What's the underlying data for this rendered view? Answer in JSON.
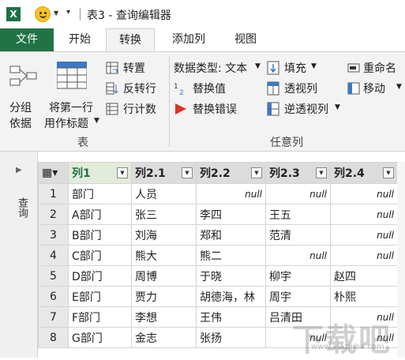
{
  "window": {
    "title": "表3 - 查询编辑器",
    "excel_badge": "X"
  },
  "tabs": [
    "文件",
    "开始",
    "转换",
    "添加列",
    "视图"
  ],
  "ribbon": {
    "group_table": {
      "label": "表",
      "group_by": [
        "分组",
        "依据"
      ],
      "use_first_row": [
        "将第一行",
        "用作标题"
      ],
      "transpose": "转置",
      "reverse_rows": "反转行",
      "count_rows": "行计数"
    },
    "group_any_column": {
      "label": "任意列",
      "data_type": "数据类型: 文本",
      "replace_values": "替换值",
      "replace_errors": "替换错误",
      "fill": "填充",
      "pivot_column": "透视列",
      "unpivot_columns": "逆透视列",
      "rename": "重命名",
      "move": "移动"
    }
  },
  "left_pane": {
    "label": "查询"
  },
  "grid": {
    "columns": [
      "列1",
      "列2.1",
      "列2.2",
      "列2.3",
      "列2.4"
    ],
    "rows": [
      [
        "1",
        "部门",
        "人员",
        "null",
        "null",
        "null"
      ],
      [
        "2",
        "A部门",
        "张三",
        "李四",
        "王五",
        "null"
      ],
      [
        "3",
        "B部门",
        "刘海",
        "郑和",
        "范清",
        "null"
      ],
      [
        "4",
        "C部门",
        "熊大",
        "熊二",
        "null",
        "null"
      ],
      [
        "5",
        "D部门",
        "周博",
        "于晓",
        "柳宇",
        "赵四"
      ],
      [
        "6",
        "E部门",
        "贾力",
        "胡德海，林",
        "周宇",
        "朴熙"
      ],
      [
        "7",
        "F部门",
        "李想",
        "王伟",
        "吕清田",
        "null"
      ],
      [
        "8",
        "G部门",
        "金志",
        "张扬",
        "null",
        "null"
      ]
    ]
  },
  "watermark": {
    "main": "下载吧",
    "sub": "www.xiazaiba.com"
  },
  "colors": {
    "accent": "#217346",
    "ribbon_bg": "#f3f3f3",
    "header_bg": "#dcdcdc"
  }
}
